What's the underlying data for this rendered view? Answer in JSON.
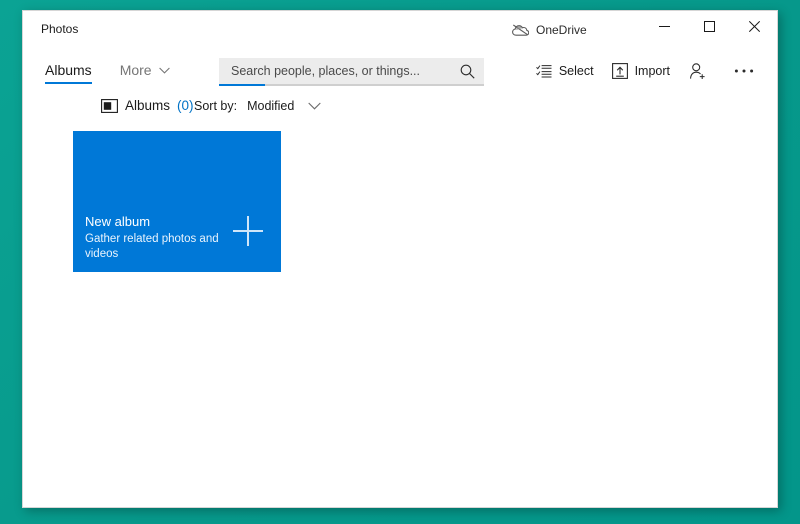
{
  "window": {
    "app_title": "Photos",
    "onedrive_label": "OneDrive",
    "caption": {
      "minimize": "─",
      "maximize": "□",
      "close": "✕"
    }
  },
  "navbar": {
    "tabs": [
      {
        "label": "Albums",
        "active": true
      },
      {
        "label": "More",
        "active": false
      }
    ],
    "search": {
      "placeholder": "Search people, places, or things...",
      "value": ""
    },
    "commands": [
      {
        "label": "Select",
        "icon": "select-checklist-icon"
      },
      {
        "label": "Import",
        "icon": "import-icon"
      },
      {
        "label": "",
        "icon": "add-person-icon"
      },
      {
        "label": "",
        "icon": "more-ellipsis-icon"
      }
    ]
  },
  "subheader": {
    "albums_label": "Albums",
    "albums_count": "(0)",
    "sort_by_label": "Sort by:",
    "sort_value": "Modified",
    "sort_options": [
      "Modified"
    ]
  },
  "content": {
    "new_album": {
      "title": "New album",
      "subtitle": "Gather related photos and videos"
    }
  },
  "colors": {
    "accent": "#0078d7",
    "tile": "#0078d7",
    "desktop": "#069b8c",
    "count_blue": "#0072c6",
    "close_hover": "#e81123"
  }
}
